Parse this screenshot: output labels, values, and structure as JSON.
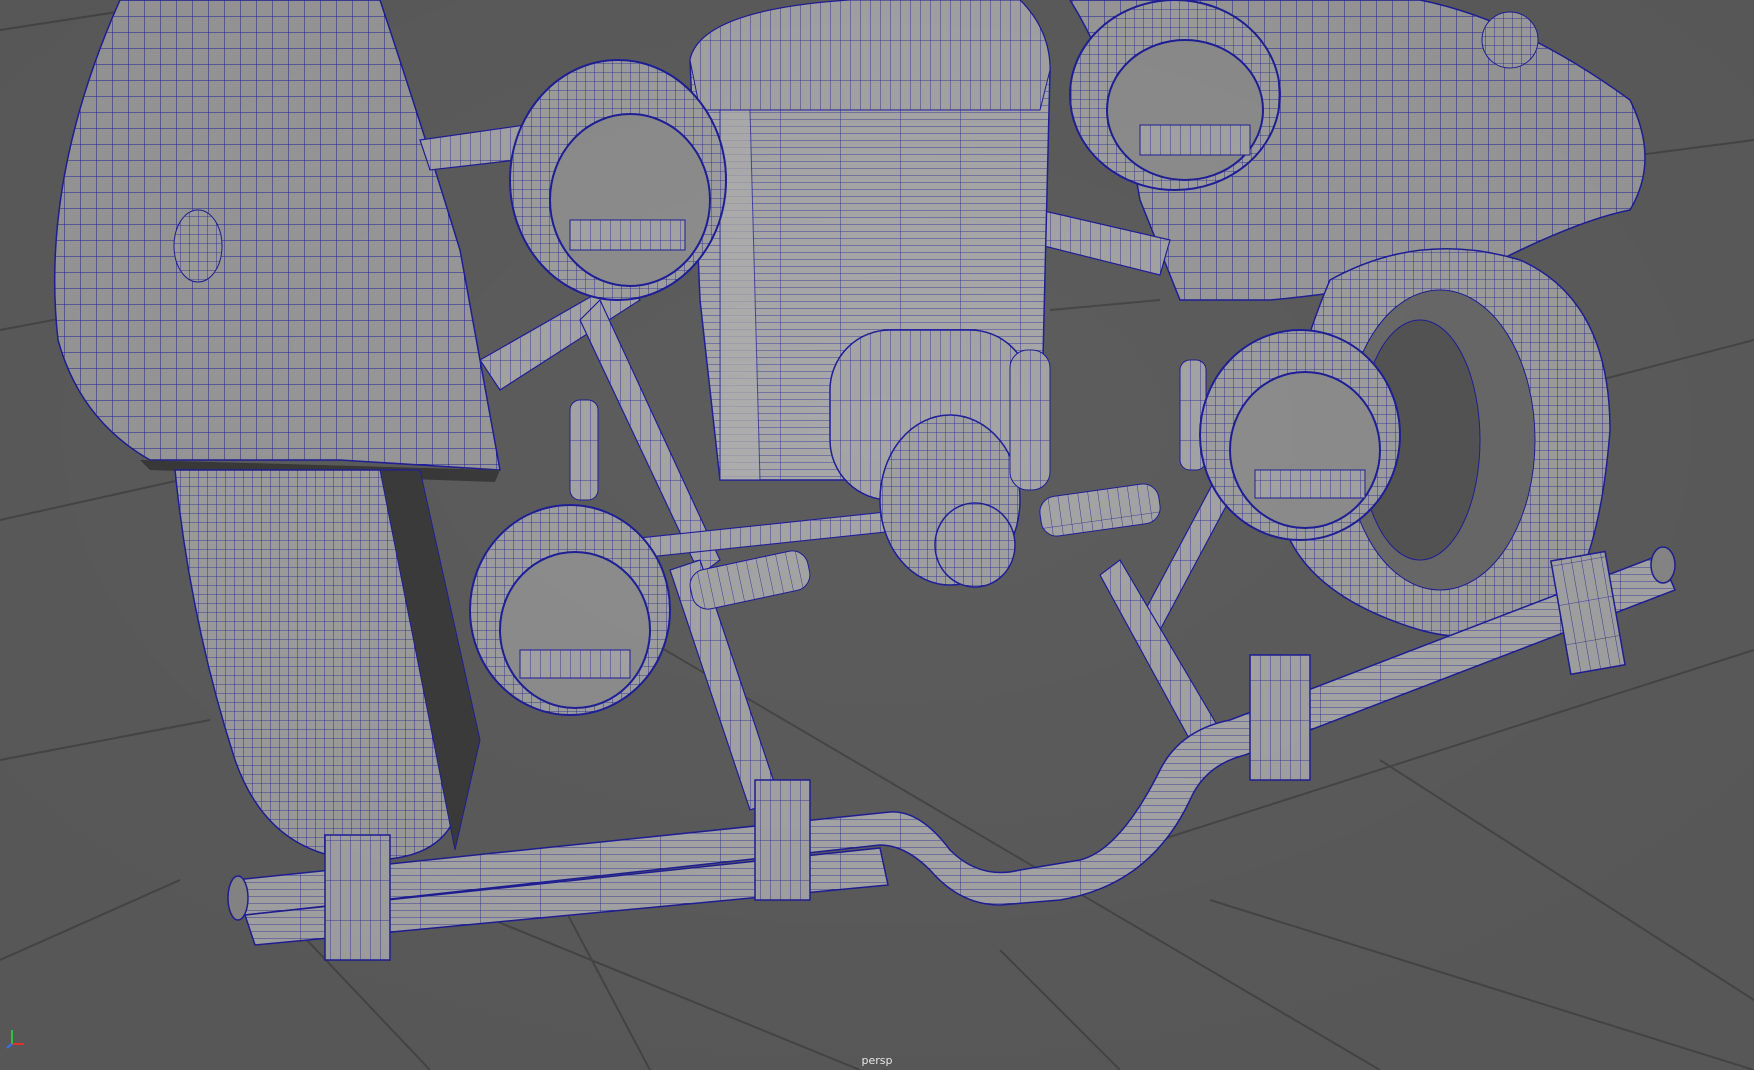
{
  "viewport": {
    "camera_name": "persp",
    "background_color": "#5d5d5d",
    "grid_color": "#474747",
    "wire_color": "#1f1f9a",
    "mesh_color": "#9d9d9d"
  },
  "axis_gizmo": {
    "x_color": "#e03030",
    "y_color": "#30c040",
    "z_color": "#3070ff"
  }
}
